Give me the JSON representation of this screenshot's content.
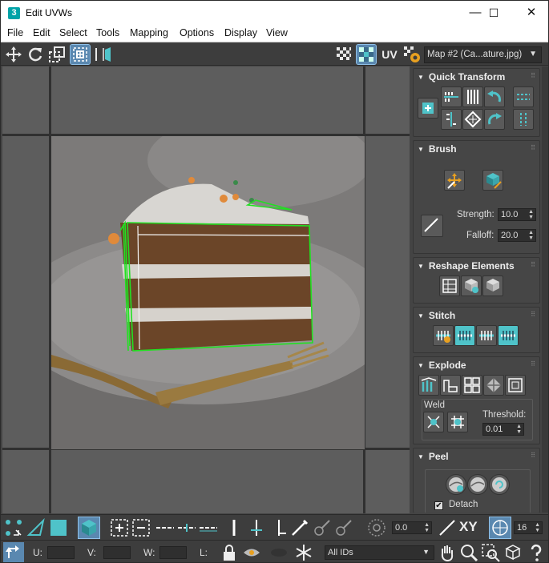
{
  "window": {
    "title": "Edit UVWs",
    "app_icon_text": "3",
    "minimize": "—",
    "maximize": "☐",
    "close": "✕"
  },
  "menu": [
    "File",
    "Edit",
    "Select",
    "Tools",
    "Mapping",
    "Options",
    "Display",
    "View"
  ],
  "toolbar": {
    "uv_label": "UV",
    "map_select": "Map #2 (Ca...ature.jpg)"
  },
  "colors": {
    "accent": "#4fc3c9",
    "selection": "#22e022",
    "panel_bg": "#444444",
    "active_button": "#5a88b0"
  },
  "panel": {
    "quick_transform": {
      "title": "Quick Transform"
    },
    "brush": {
      "title": "Brush",
      "strength_label": "Strength:",
      "strength_value": "10.0",
      "falloff_label": "Falloff:",
      "falloff_value": "20.0"
    },
    "reshape": {
      "title": "Reshape Elements"
    },
    "stitch": {
      "title": "Stitch"
    },
    "explode": {
      "title": "Explode",
      "weld_label": "Weld",
      "threshold_label": "Threshold:",
      "threshold_value": "0.01"
    },
    "peel": {
      "title": "Peel",
      "detach_label": "Detach",
      "detach_checked": true
    }
  },
  "bottom": {
    "angle_value": "0.0",
    "xy_label": "XY",
    "snap_value": "16",
    "u_label": "U:",
    "v_label": "V:",
    "w_label": "W:",
    "l_label": "L:",
    "ids_select": "All IDs"
  }
}
